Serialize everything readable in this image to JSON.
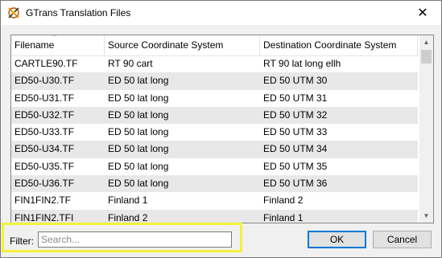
{
  "window": {
    "title": "GTrans Translation Files",
    "close_glyph": "✕",
    "icon": "gtrans-app-icon"
  },
  "table": {
    "columns": [
      "Filename",
      "Source Coordinate System",
      "Destination Coordinate System"
    ],
    "sorted_column": "Filename",
    "rows": [
      [
        "CARTLE90.TF",
        "RT 90 cart",
        "RT 90 lat long ellh"
      ],
      [
        "ED50-U30.TF",
        "ED 50 lat long",
        "ED 50 UTM 30"
      ],
      [
        "ED50-U31.TF",
        "ED 50 lat long",
        "ED 50 UTM 31"
      ],
      [
        "ED50-U32.TF",
        "ED 50 lat long",
        "ED 50 UTM 32"
      ],
      [
        "ED50-U33.TF",
        "ED 50 lat long",
        "ED 50 UTM 33"
      ],
      [
        "ED50-U34.TF",
        "ED 50 lat long",
        "ED 50 UTM 34"
      ],
      [
        "ED50-U35.TF",
        "ED 50 lat long",
        "ED 50 UTM 35"
      ],
      [
        "ED50-U36.TF",
        "ED 50 lat long",
        "ED 50 UTM 36"
      ],
      [
        "FIN1FIN2.TF",
        "Finland 1",
        "Finland 2"
      ],
      [
        "FIN1FIN2.TFI",
        "Finland 2",
        "Finland 1"
      ]
    ]
  },
  "filter": {
    "label": "Filter:",
    "value": "",
    "placeholder": "Search..."
  },
  "buttons": {
    "ok": "OK",
    "cancel": "Cancel"
  },
  "colors": {
    "highlight": "#f2f23a",
    "default_button_border": "#0078d7",
    "alt_row": "#e8e8e8"
  }
}
